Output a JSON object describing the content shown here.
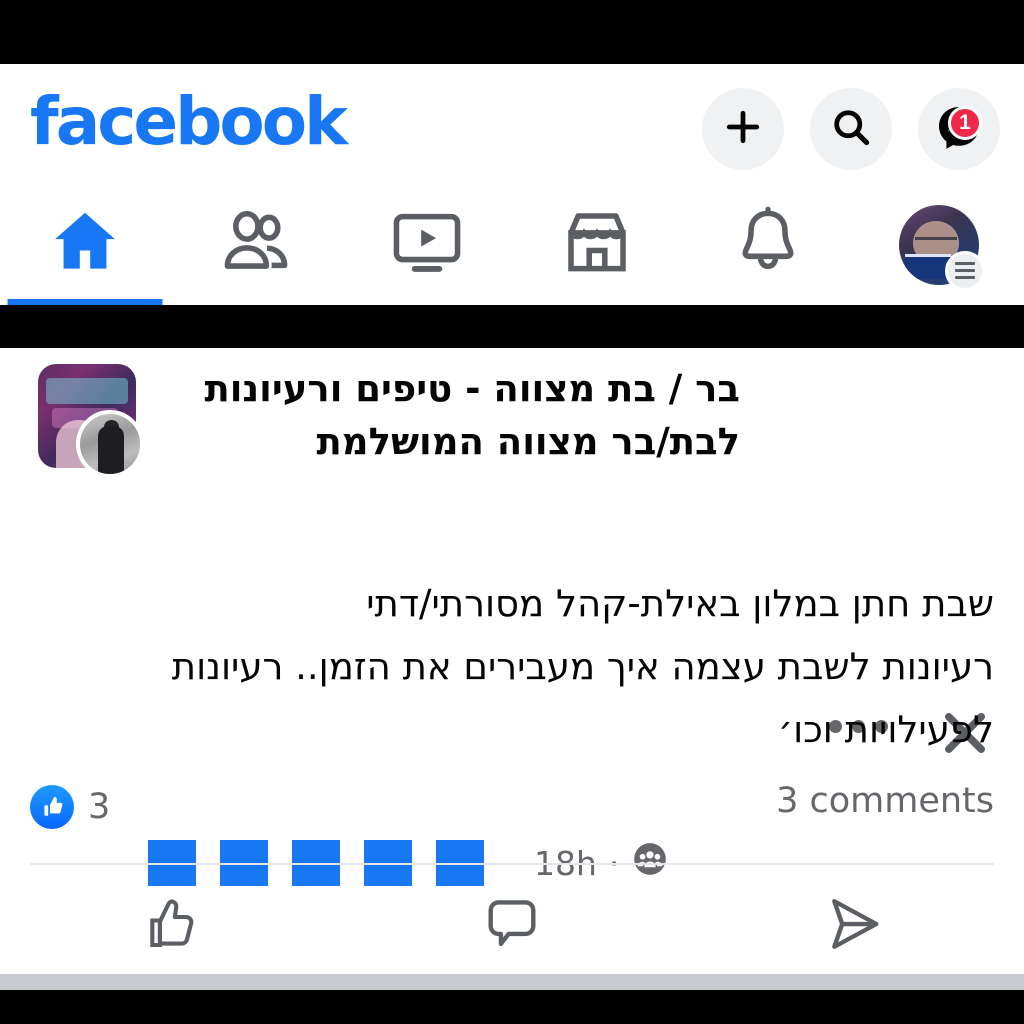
{
  "app": {
    "brand": "facebook",
    "brand_color": "#1877f2"
  },
  "header": {
    "actions": [
      {
        "name": "create",
        "icon": "plus-icon"
      },
      {
        "name": "search",
        "icon": "search-icon"
      },
      {
        "name": "messenger",
        "icon": "messenger-icon",
        "badge": "1"
      }
    ],
    "messenger_badge": "1",
    "badge_color": "#f02849"
  },
  "nav": {
    "tabs": [
      {
        "label": "Home",
        "icon": "home-icon",
        "active": true
      },
      {
        "label": "Friends",
        "icon": "friends-icon",
        "active": false
      },
      {
        "label": "Watch",
        "icon": "video-icon",
        "active": false
      },
      {
        "label": "Marketplace",
        "icon": "store-icon",
        "active": false
      },
      {
        "label": "Notifications",
        "icon": "bell-icon",
        "active": false
      },
      {
        "label": "Menu",
        "icon": "avatar-menu-icon",
        "active": false
      }
    ],
    "active_indicator_color": "#1877f2"
  },
  "post": {
    "group_name": "בר / בת מצווה - טיפים ורעיונות לבת/בר מצווה המושלמת",
    "author_redacted_blocks": 5,
    "redaction_color": "#1877f2",
    "timestamp": "18h",
    "separator": "·",
    "audience_icon": "group-privacy-icon",
    "body": "שבת חתן במלון באילת-קהל מסורתי/דתי\nרעיונות לשבת עצמה איך מעבירים את הזמן.. רעיונות לפעילויות  וכו׳",
    "reaction_count": "3",
    "reaction_icon": "thumbs-up-filled-icon",
    "comments_label": "3 comments",
    "menu_icon": "more-options-icon",
    "close_icon": "close-icon",
    "actions": [
      {
        "label": "Like",
        "icon": "thumbs-up-outline-icon"
      },
      {
        "label": "Comment",
        "icon": "comment-bubble-icon"
      },
      {
        "label": "Share",
        "icon": "share-send-icon"
      }
    ]
  }
}
